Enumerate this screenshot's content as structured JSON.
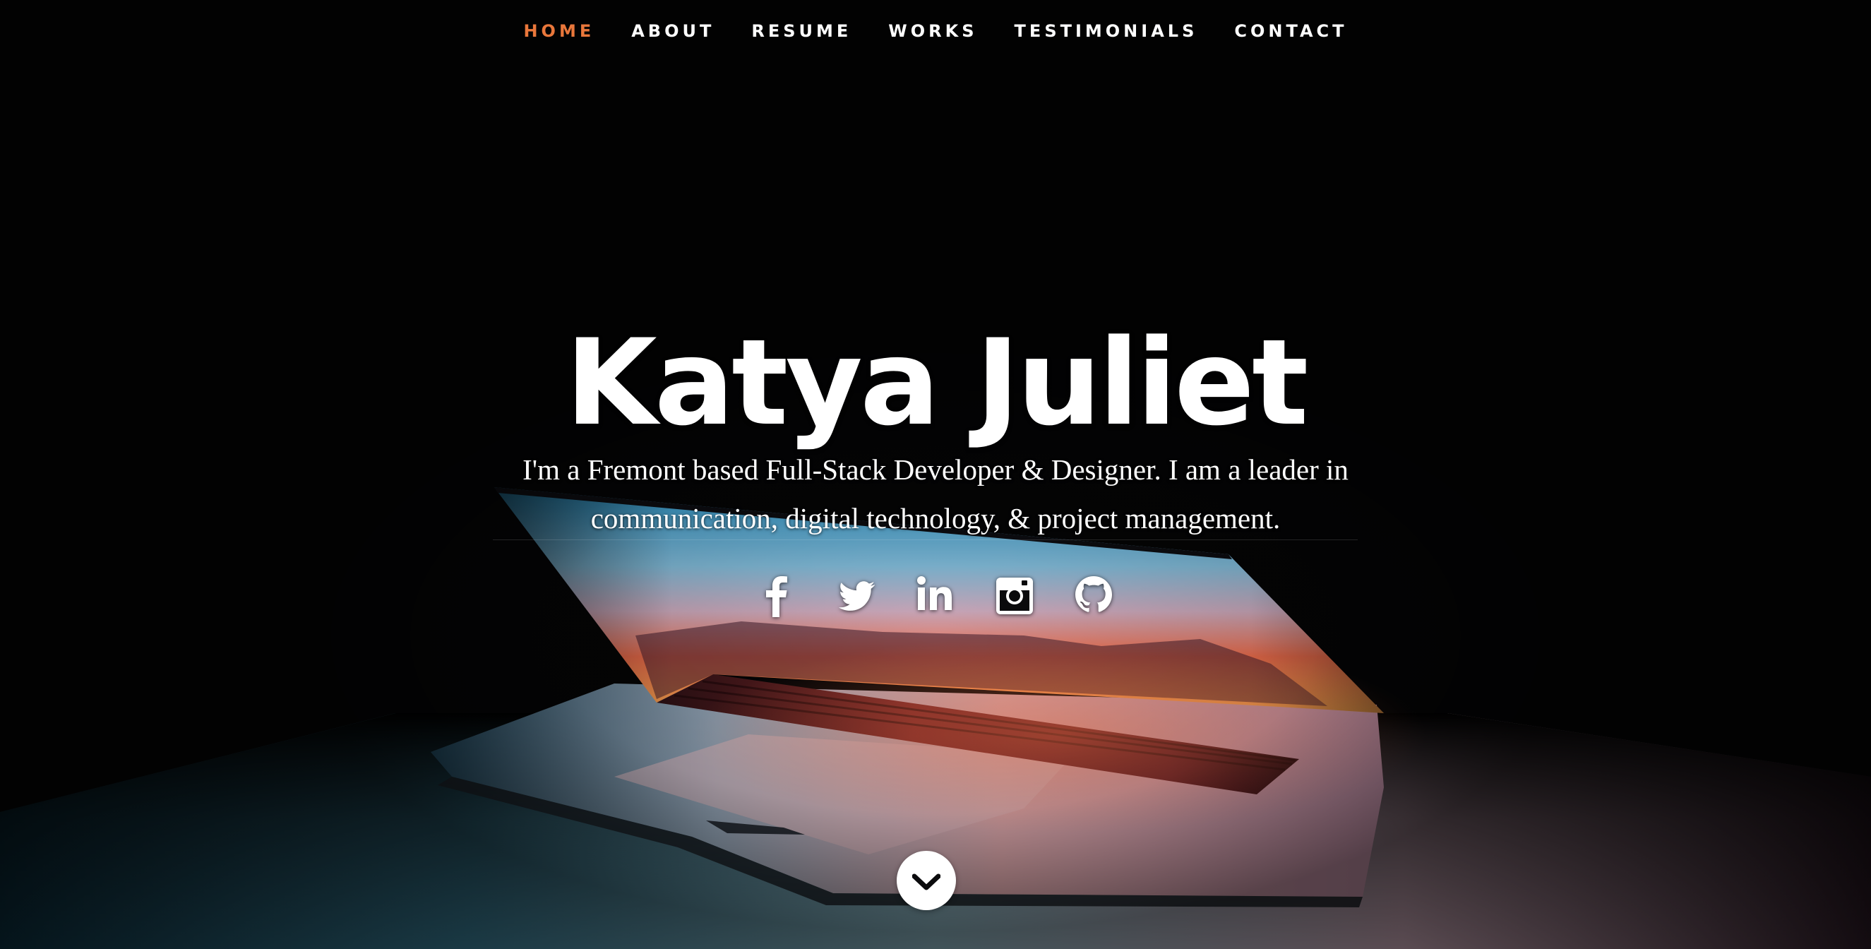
{
  "nav": {
    "items": [
      {
        "label": "HOME",
        "active": true
      },
      {
        "label": "ABOUT",
        "active": false
      },
      {
        "label": "RESUME",
        "active": false
      },
      {
        "label": "WORKS",
        "active": false
      },
      {
        "label": "TESTIMONIALS",
        "active": false
      },
      {
        "label": "CONTACT",
        "active": false
      }
    ],
    "active_color": "#e9773b",
    "text_color": "#ffffff"
  },
  "banner": {
    "name": "Katya Juliet",
    "tagline_line1": "I'm a Fremont based Full-Stack Developer & Designer. I am a leader in",
    "tagline_line2": "communication, digital technology, & project management."
  },
  "social": {
    "icons": [
      "facebook-icon",
      "twitter-icon",
      "linkedin-icon",
      "instagram-icon",
      "github-icon"
    ]
  },
  "scroll_button": {
    "icon": "chevron-down-icon"
  }
}
